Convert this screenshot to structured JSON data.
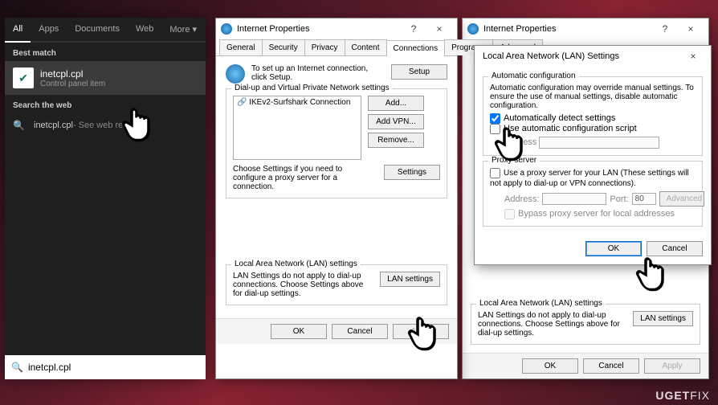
{
  "search": {
    "tabs": [
      "All",
      "Apps",
      "Documents",
      "Web",
      "More"
    ],
    "best_match_label": "Best match",
    "result_title": "inetcpl.cpl",
    "result_subtitle": "Control panel item",
    "search_web_label": "Search the web",
    "web_result_text": "inetcpl.cpl",
    "web_result_suffix": " - See web results",
    "input_value": "inetcpl.cpl"
  },
  "ip_dialog": {
    "title": "Internet Properties",
    "help": "?",
    "close": "×",
    "tabs": [
      "General",
      "Security",
      "Privacy",
      "Content",
      "Connections",
      "Programs",
      "Advanced"
    ],
    "active_tab_index": 4,
    "setup_desc": "To set up an Internet connection, click Setup.",
    "setup_btn": "Setup",
    "vpn_group": "Dial-up and Virtual Private Network settings",
    "vpn_item": "IKEv2-Surfshark Connection",
    "add_btn": "Add...",
    "add_vpn_btn": "Add VPN...",
    "remove_btn": "Remove...",
    "settings_btn": "Settings",
    "settings_desc": "Choose Settings if you need to configure a proxy server for a connection.",
    "lan_group": "Local Area Network (LAN) settings",
    "lan_desc": "LAN Settings do not apply to dial-up connections. Choose Settings above for dial-up settings.",
    "lan_btn": "LAN settings",
    "ok": "OK",
    "cancel": "Cancel",
    "apply": "Apply"
  },
  "lan_dialog": {
    "title": "Local Area Network (LAN) Settings",
    "close": "×",
    "auto_group": "Automatic configuration",
    "auto_desc": "Automatic configuration may override manual settings. To ensure the use of manual settings, disable automatic configuration.",
    "auto_detect": "Automatically detect settings",
    "auto_script": "Use automatic configuration script",
    "address_label": "Address",
    "proxy_group": "Proxy server",
    "proxy_use": "Use a proxy server for your LAN (These settings will not apply to dial-up or VPN connections).",
    "proxy_addr_label": "Address:",
    "proxy_port_label": "Port:",
    "proxy_port_value": "80",
    "advanced_btn": "Advanced",
    "bypass": "Bypass proxy server for local addresses",
    "ok": "OK",
    "cancel": "Cancel"
  },
  "behind_dialog": {
    "title": "Internet Properties",
    "lan_group": "Local Area Network (LAN) settings",
    "lan_desc": "LAN Settings do not apply to dial-up connections. Choose Settings above for dial-up settings.",
    "lan_btn": "LAN settings",
    "ok": "OK",
    "cancel": "Cancel",
    "apply": "Apply"
  },
  "watermark_left": "UGET",
  "watermark_right": "FIX"
}
